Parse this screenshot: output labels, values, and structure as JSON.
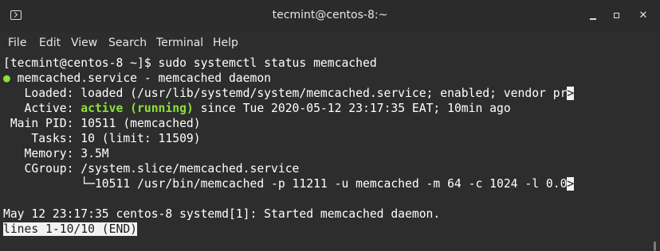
{
  "window": {
    "title": "tecmint@centos-8:~",
    "minimize_glyph": "",
    "maximize_glyph": "",
    "close_glyph": "✕"
  },
  "menu": {
    "file": "File",
    "edit": "Edit",
    "view": "View",
    "search": "Search",
    "terminal": "Terminal",
    "help": "Help"
  },
  "terminal": {
    "prompt_line": "[tecmint@centos-8 ~]$ sudo systemctl status memcached",
    "service_dot": "●",
    "service_line": " memcached.service - memcached daemon",
    "loaded_line": "   Loaded: loaded (/usr/lib/systemd/system/memcached.service; enabled; vendor pr",
    "overflow_marker": ">",
    "active_label": "   Active: ",
    "active_state": "active (running)",
    "active_rest": " since Tue 2020-05-12 23:17:35 EAT; 10min ago",
    "main_pid_line": " Main PID: 10511 (memcached)",
    "tasks_line": "    Tasks: 10 (limit: 11509)",
    "memory_line": "   Memory: 3.5M",
    "cgroup_line": "   CGroup: /system.slice/memcached.service",
    "cgroup_child_line": "           └─10511 /usr/bin/memcached -p 11211 -u memcached -m 64 -c 1024 -l 0.0",
    "log_line": "May 12 23:17:35 centos-8 systemd[1]: Started memcached daemon.",
    "pager_status": "lines 1-10/10 (END)"
  },
  "colors": {
    "background": "#2d2d2d",
    "foreground": "#ffffff",
    "accent_green": "#8ae234",
    "status_bar_bg": "#f2f2f2"
  },
  "icons": {
    "terminal_app": "terminal-icon",
    "minimize": "minimize-icon",
    "maximize": "maximize-icon",
    "close": "close-icon"
  }
}
